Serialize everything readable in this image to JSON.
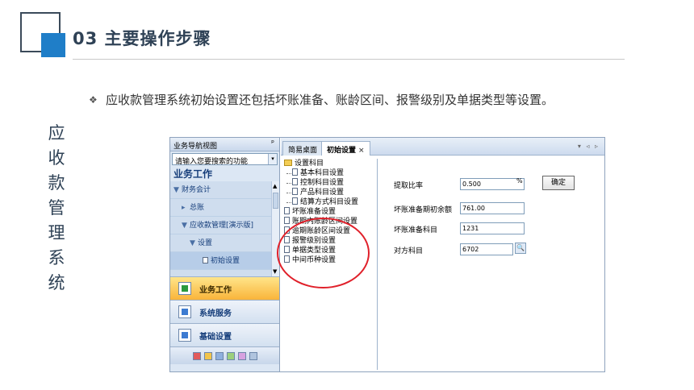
{
  "slide": {
    "title": "03  主要操作步骤",
    "bullet_mark": "❖",
    "bullet_text": "应收款管理系统初始设置还包括坏账准备、账龄区间、报警级别及单据类型等设置。",
    "vertical_title": [
      "应",
      "收",
      "款",
      "管",
      "理",
      "系",
      "统"
    ]
  },
  "nav": {
    "header": "业务导航视图",
    "pin": "ᵖ",
    "search_placeholder": "请输入您要搜索的功能",
    "section": "业务工作",
    "tree": [
      {
        "arrow": "▼",
        "label": "财务会计"
      },
      {
        "arrow": "▸",
        "label": "总账"
      },
      {
        "arrow": "▼",
        "label": "应收款管理[演示版]"
      },
      {
        "arrow": "▼",
        "label": "设置"
      },
      {
        "arrow": "",
        "label": "初始设置"
      }
    ],
    "buttons": [
      {
        "label": "业务工作"
      },
      {
        "label": "系统服务"
      },
      {
        "label": "基础设置"
      }
    ]
  },
  "tabs": {
    "tab1": "简易桌面",
    "tab2": "初始设置",
    "close": "×",
    "controls": "▾ ◃ ▹"
  },
  "settings_tree": [
    {
      "label": "设置科目"
    },
    {
      "label": "基本科目设置"
    },
    {
      "label": "控制科目设置"
    },
    {
      "label": "产品科目设置"
    },
    {
      "label": "结算方式科目设置"
    },
    {
      "label": "坏账准备设置"
    },
    {
      "label": "账期内账龄区间设置"
    },
    {
      "label": "逾期账龄区间设置"
    },
    {
      "label": "报警级别设置"
    },
    {
      "label": "单据类型设置"
    },
    {
      "label": "中间币种设置"
    }
  ],
  "form": {
    "ratio_label": "提取比率",
    "ratio_value": "0.500",
    "ratio_unit": "%",
    "confirm": "确定",
    "balance_label": "坏账准备期初余额",
    "balance_value": "761.00",
    "account_label": "坏账准备科目",
    "account_value": "1231",
    "contra_label": "对方科目",
    "contra_value": "6702",
    "search_icon": "🔍"
  },
  "colors": {
    "accent": "#1f7ec8",
    "highlight_circle": "#e0202a",
    "active_button": "#f9b43a"
  }
}
